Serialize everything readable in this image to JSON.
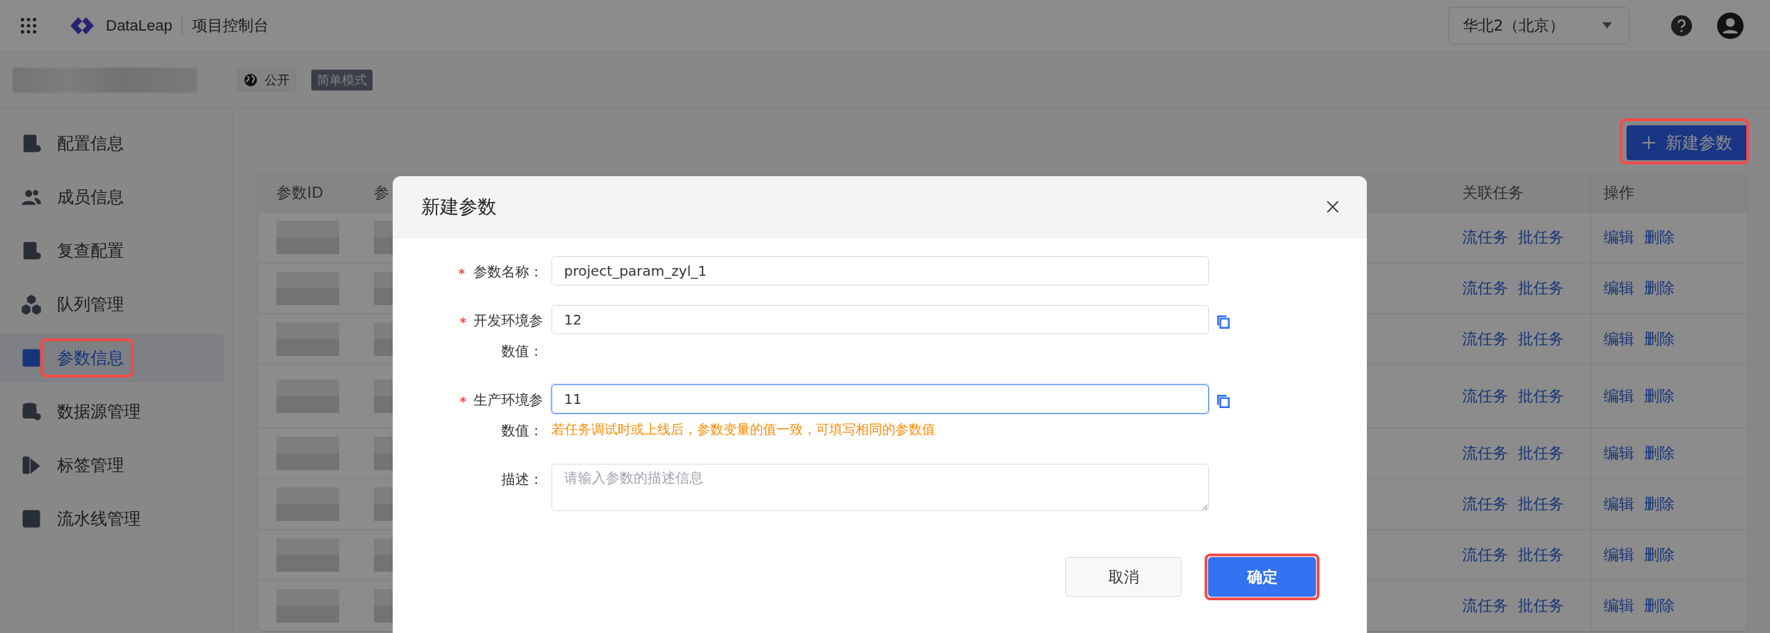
{
  "topbar": {
    "product": "DataLeap",
    "console": "项目控制台",
    "region": "华北2（北京）"
  },
  "project": {
    "visibility": "公开",
    "mode": "简单模式"
  },
  "sidebar": {
    "items": [
      {
        "label": "配置信息",
        "selected": false,
        "highlighted": false
      },
      {
        "label": "成员信息",
        "selected": false,
        "highlighted": false
      },
      {
        "label": "复查配置",
        "selected": false,
        "highlighted": false
      },
      {
        "label": "队列管理",
        "selected": false,
        "highlighted": false
      },
      {
        "label": "参数信息",
        "selected": true,
        "highlighted": true
      },
      {
        "label": "数据源管理",
        "selected": false,
        "highlighted": false
      },
      {
        "label": "标签管理",
        "selected": false,
        "highlighted": false
      },
      {
        "label": "流水线管理",
        "selected": false,
        "highlighted": false
      }
    ]
  },
  "toolbar": {
    "new_button": {
      "label": "新建参数",
      "highlighted": true
    }
  },
  "table": {
    "columns": [
      "参数ID",
      "参",
      "关联任务",
      "操作"
    ],
    "rows": [
      {
        "tasks": [
          "流任务",
          "批任务"
        ],
        "actions": [
          "编辑",
          "删除"
        ]
      },
      {
        "tasks": [
          "流任务",
          "批任务"
        ],
        "actions": [
          "编辑",
          "删除"
        ]
      },
      {
        "tasks": [
          "流任务",
          "批任务"
        ],
        "actions": [
          "编辑",
          "删除"
        ]
      },
      {
        "tasks": [
          "流任务",
          "批任务"
        ],
        "actions": [
          "编辑",
          "删除"
        ]
      },
      {
        "tasks": [
          "流任务",
          "批任务"
        ],
        "actions": [
          "编辑",
          "删除"
        ]
      },
      {
        "tasks": [
          "流任务",
          "批任务"
        ],
        "actions": [
          "编辑",
          "删除"
        ]
      },
      {
        "tasks": [
          "流任务",
          "批任务"
        ],
        "actions": [
          "编辑",
          "删除"
        ]
      },
      {
        "tasks": [
          "流任务",
          "批任务"
        ],
        "actions": [
          "编辑",
          "删除"
        ]
      }
    ]
  },
  "dialog": {
    "title": "新建参数",
    "fields": [
      {
        "kind": "input",
        "label": "参数名称：",
        "required": true,
        "value": "project_param_zyl_1",
        "copy": false,
        "focused": false
      },
      {
        "kind": "input",
        "label": "开发环境参数值：",
        "required": true,
        "value": "12",
        "copy": true,
        "focused": false
      },
      {
        "kind": "input",
        "label": "生产环境参数值：",
        "required": true,
        "value": "11",
        "copy": true,
        "focused": true,
        "hint": "若任务调试时或上线后，参数变量的值一致，可填写相同的参数值"
      },
      {
        "kind": "textarea",
        "label": "描述：",
        "required": false,
        "placeholder": "请输入参数的描述信息",
        "copy": false,
        "focused": false
      }
    ],
    "buttons": [
      {
        "label": "取消",
        "kind": "secondary",
        "highlighted": false
      },
      {
        "label": "确定",
        "kind": "primary",
        "highlighted": true
      }
    ]
  }
}
